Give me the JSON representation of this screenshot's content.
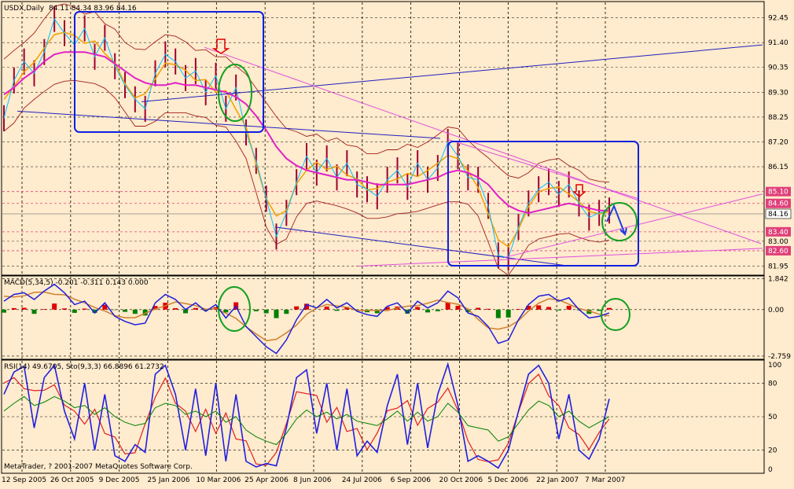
{
  "chart_data": {
    "type": "line",
    "main": {
      "title": "USDX,Daily",
      "ohlc": "84.11 84.34 83.96 84.16",
      "ylim": [
        81.6,
        93.1
      ],
      "yticks": [
        "92.45",
        "91.40",
        "90.35",
        "89.30",
        "88.25",
        "87.20",
        "86.15",
        "85.10",
        "84.60",
        "84.16",
        "83.40",
        "83.00",
        "82.60",
        "81.95"
      ],
      "ytick_values": [
        92.45,
        91.4,
        90.35,
        89.3,
        88.25,
        87.2,
        86.15,
        85.1,
        84.6,
        84.16,
        83.4,
        83.0,
        82.6,
        81.95
      ],
      "marked_levels": {
        "85.10": "#E0407A",
        "84.60": "#E0407A",
        "83.40": "#E0407A",
        "82.60": "#E0407A"
      },
      "current_level": "84.16",
      "price_series": [
        88.2,
        89.8,
        90.6,
        90.1,
        91.0,
        92.4,
        91.8,
        91.3,
        92.0,
        90.8,
        91.6,
        90.4,
        89.6,
        89.0,
        88.6,
        90.1,
        90.9,
        90.6,
        89.9,
        90.2,
        89.3,
        90.0,
        88.6,
        89.5,
        87.6,
        86.4,
        84.8,
        83.2,
        84.2,
        85.5,
        86.6,
        85.9,
        86.5,
        85.7,
        86.3,
        85.4,
        85.2,
        84.9,
        85.6,
        86.0,
        85.3,
        86.3,
        85.6,
        86.1,
        87.2,
        86.6,
        85.7,
        85.6,
        84.5,
        82.4,
        82.3,
        83.6,
        84.6,
        85.2,
        85.5,
        85.0,
        85.4,
        84.6,
        84.0,
        84.2,
        84.3
      ],
      "ma_series": [
        89.2,
        89.5,
        89.9,
        90.2,
        90.6,
        90.9,
        91.0,
        91.0,
        91.0,
        90.9,
        90.8,
        90.5,
        90.2,
        89.9,
        89.7,
        89.6,
        89.6,
        89.7,
        89.6,
        89.6,
        89.5,
        89.4,
        89.3,
        89.1,
        88.8,
        88.3,
        87.7,
        87.0,
        86.5,
        86.2,
        86.0,
        85.9,
        85.8,
        85.7,
        85.6,
        85.6,
        85.5,
        85.4,
        85.4,
        85.4,
        85.4,
        85.5,
        85.6,
        85.7,
        85.9,
        86.0,
        85.9,
        85.7,
        85.4,
        84.9,
        84.5,
        84.3,
        84.2,
        84.3,
        84.4,
        84.5,
        84.6,
        84.5,
        84.4,
        84.3,
        84.3
      ]
    },
    "macd": {
      "title": "MACD(5,34,5) -0.201 -0.311 0.143 0.000",
      "ylim": [
        -2.9,
        1.95
      ],
      "yticks": [
        "1.842",
        "0.00",
        "-2.759"
      ],
      "ytick_values": [
        1.842,
        0.0,
        -2.759
      ],
      "series": [
        0.5,
        0.9,
        1.0,
        0.6,
        1.1,
        1.5,
        1.0,
        0.3,
        0.5,
        -0.2,
        0.4,
        -0.4,
        -0.7,
        -0.9,
        -0.8,
        0.4,
        0.9,
        0.6,
        0.0,
        0.4,
        -0.1,
        0.3,
        -0.5,
        0.2,
        -1.0,
        -1.6,
        -2.2,
        -2.6,
        -1.8,
        -0.6,
        0.3,
        0.1,
        0.6,
        0.1,
        0.4,
        -0.1,
        -0.3,
        -0.4,
        0.2,
        0.4,
        -0.2,
        0.5,
        0.1,
        0.4,
        1.1,
        0.7,
        -0.2,
        -0.4,
        -1.0,
        -2.0,
        -1.8,
        -0.6,
        0.3,
        0.8,
        0.9,
        0.5,
        0.7,
        0.0,
        -0.5,
        -0.4,
        -0.2
      ]
    },
    "rsi": {
      "title": "RSI(14) 49.6705, Sto(9,3,3) 66.8896 61.2732",
      "ylim": [
        0,
        100
      ],
      "yticks": [
        "100",
        "80",
        "50",
        "20",
        "0"
      ],
      "ytick_values": [
        100,
        80,
        50,
        20,
        0
      ],
      "stoch_series": [
        70,
        90,
        95,
        40,
        85,
        96,
        55,
        30,
        80,
        20,
        70,
        15,
        10,
        25,
        18,
        88,
        96,
        70,
        20,
        75,
        15,
        80,
        10,
        70,
        10,
        5,
        8,
        6,
        40,
        85,
        92,
        35,
        80,
        20,
        75,
        15,
        28,
        18,
        60,
        88,
        25,
        80,
        22,
        70,
        97,
        60,
        10,
        15,
        10,
        4,
        20,
        55,
        88,
        96,
        80,
        30,
        70,
        20,
        12,
        30,
        66
      ],
      "rsi_series": [
        55,
        62,
        68,
        60,
        63,
        68,
        64,
        58,
        60,
        52,
        58,
        50,
        45,
        42,
        44,
        58,
        62,
        60,
        52,
        55,
        50,
        55,
        45,
        50,
        38,
        32,
        28,
        25,
        35,
        48,
        56,
        50,
        54,
        48,
        52,
        46,
        44,
        42,
        48,
        55,
        46,
        54,
        46,
        50,
        62,
        54,
        42,
        40,
        38,
        28,
        32,
        44,
        56,
        64,
        60,
        50,
        55,
        46,
        40,
        45,
        50
      ]
    },
    "x_ticks": [
      "12 Sep 2005",
      "26 Oct 2005",
      "9 Dec 2005",
      "25 Jan 2006",
      "10 Mar 2006",
      "25 Apr 2006",
      "8 Jun 2006",
      "24 Jul 2006",
      "6 Sep 2006",
      "20 Oct 2006",
      "5 Dec 2006",
      "22 Jan 2007",
      "7 Mar 2007"
    ],
    "grid": true,
    "colors": {
      "background": "#FFEBCD",
      "price": "#1E1EDC",
      "bars": "#A00030",
      "ma": "#E020C8",
      "bands": "#A0201C",
      "ema": "#F0A000",
      "cyan": "#00BFFF",
      "trend": "#2020C0",
      "trend_magenta": "#E050E0",
      "macd_pos": "#E00000",
      "macd_neg": "#008000",
      "signal": "#D08030",
      "rsi": "#008000",
      "stoch": "#2020E0",
      "box": "#1020E0",
      "circle": "#10A020",
      "arrow": "#E00000"
    }
  },
  "footer": "MetaTrader, ? 2001-2007 MetaQuotes Software Corp."
}
